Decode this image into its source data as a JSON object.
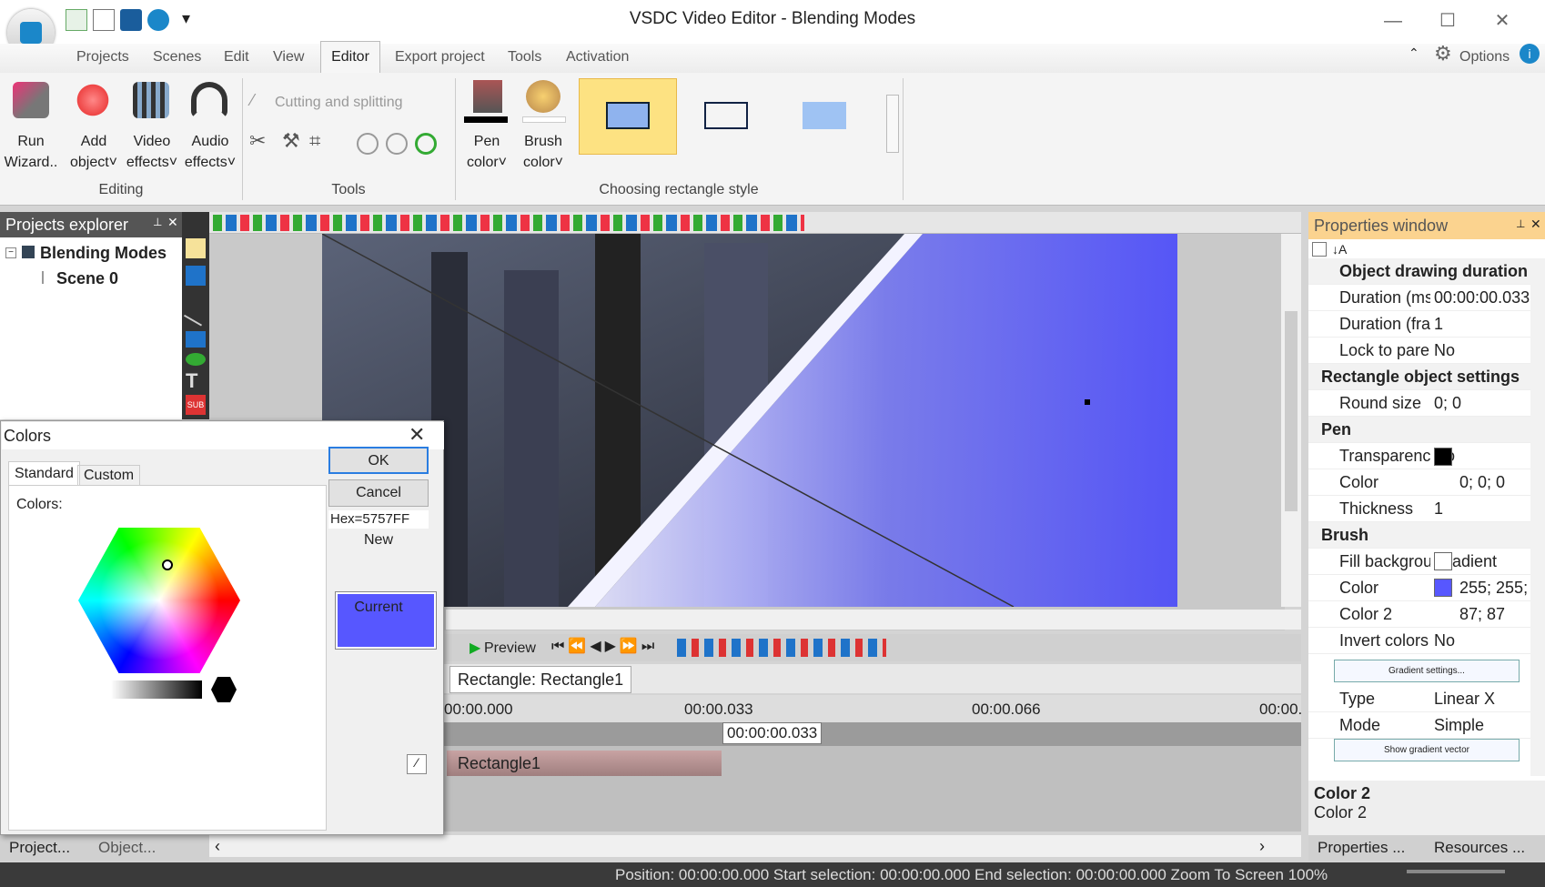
{
  "window": {
    "title": "VSDC Video Editor - Blending Modes",
    "minimize": "—",
    "maximize": "☐",
    "close": "✕"
  },
  "menu": {
    "items": [
      "Projects",
      "Scenes",
      "Edit",
      "View",
      "Editor",
      "Export project",
      "Tools",
      "Activation"
    ],
    "options": "Options",
    "active": "Editor"
  },
  "ribbon": {
    "editing": {
      "run": "Run",
      "run2": "Wizard..",
      "add": "Add",
      "add2": "object",
      "video": "Video",
      "video2": "effects",
      "audio": "Audio",
      "audio2": "effects",
      "group": "Editing"
    },
    "tools": {
      "cutting": "Cutting and splitting",
      "group": "Tools"
    },
    "colors": {
      "pen": "Pen",
      "pen2": "color",
      "brush": "Brush",
      "brush2": "color"
    },
    "styles": {
      "group": "Choosing rectangle style"
    }
  },
  "projects": {
    "header": "Projects explorer",
    "root": "Blending Modes",
    "scene": "Scene 0"
  },
  "preview": {
    "label": "Preview"
  },
  "timeline": {
    "tab": "Rectangle: Rectangle1",
    "marks": [
      "00:00.000",
      "00:00.033",
      "00:00.066",
      "00:00."
    ],
    "cursor": "00:00:00.033",
    "clip": "Rectangle1"
  },
  "props": {
    "header": "Properties window",
    "rows": [
      {
        "name": "Object drawing duration",
        "val": "",
        "sec": true
      },
      {
        "name": "Duration (ms",
        "val": "00:00:00.033"
      },
      {
        "name": "Duration (fra",
        "val": "1"
      },
      {
        "name": "Lock to pare",
        "val": "No"
      },
      {
        "name": "Rectangle object settings",
        "val": "",
        "sec": true
      },
      {
        "name": "Round size",
        "val": "0; 0"
      },
      {
        "name": "Pen",
        "val": "",
        "sec": true
      },
      {
        "name": "Transparency",
        "val": "No"
      },
      {
        "name": "Color",
        "val": "0; 0; 0"
      },
      {
        "name": "Thickness",
        "val": "1"
      },
      {
        "name": "Brush",
        "val": "",
        "sec": true
      },
      {
        "name": "Fill backgrou",
        "val": "Gradient"
      },
      {
        "name": "Color",
        "val": "255; 255;"
      },
      {
        "name": "Color 2",
        "val": "87; 87"
      },
      {
        "name": "Invert colors",
        "val": "No"
      },
      {
        "name": "Type",
        "val": "Linear X"
      },
      {
        "name": "Mode",
        "val": "Simple"
      }
    ],
    "gradient_btn": "Gradient settings...",
    "vector_btn": "Show gradient vector",
    "desc_title": "Color 2",
    "desc_text": "Color 2",
    "tab1": "Properties ...",
    "tab2": "Resources ..."
  },
  "dock": {
    "tab1": "Project...",
    "tab2": "Object..."
  },
  "status": {
    "text": "Position:  00:00:00.000  Start selection:  00:00:00.000  End selection:  00:00:00.000  Zoom To Screen   100%"
  },
  "dialog": {
    "title": "Colors",
    "tab_standard": "Standard",
    "tab_custom": "Custom",
    "colors_label": "Colors:",
    "ok": "OK",
    "cancel": "Cancel",
    "hex": "Hex=5757FF",
    "new": "New",
    "current": "Current",
    "swatch_color": "#5757ff"
  }
}
